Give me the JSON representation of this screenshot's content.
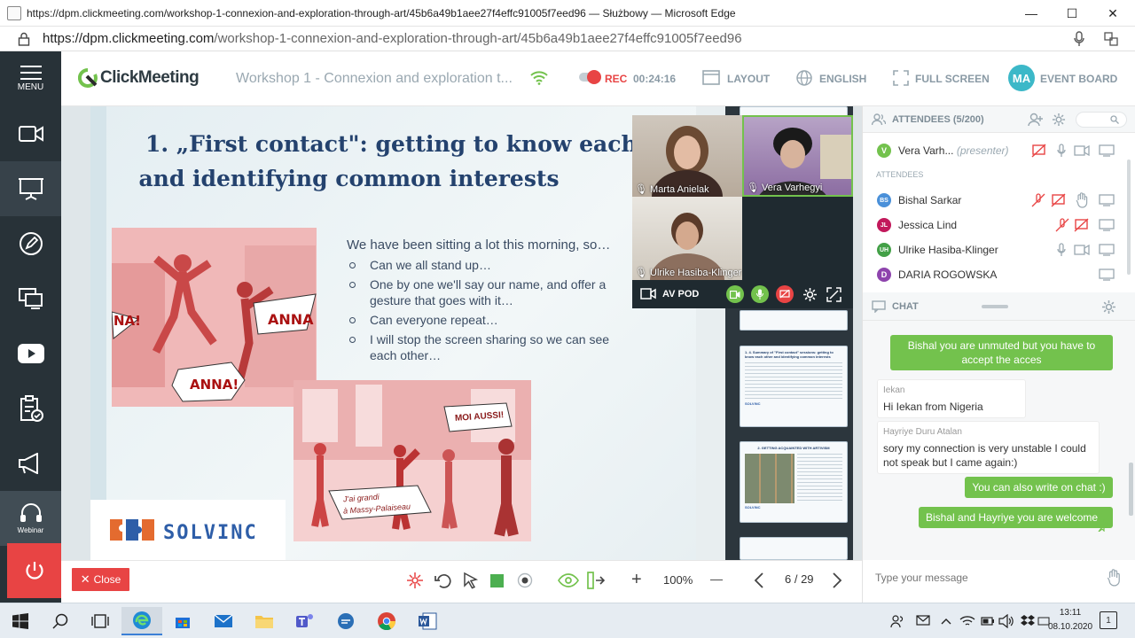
{
  "window": {
    "title": "https://dpm.clickmeeting.com/workshop-1-connexion-and-exploration-through-art/45b6a49b1aee27f4effc91005f7eed96 — Służbowy — Microsoft Edge",
    "minimize": "—",
    "maximize": "☐",
    "close": "✕"
  },
  "address": {
    "host": "https://dpm.clickmeeting.com",
    "path": "/workshop-1-connexion-and-exploration-through-art/45b6a49b1aee27f4effc91005f7eed96"
  },
  "sidebar": {
    "menu_label": "MENU",
    "webinar_label": "Webinar"
  },
  "header": {
    "logo": "ClickMeeting",
    "meeting_title": "Workshop 1 - Connexion and exploration t...",
    "rec_label": "REC",
    "rec_time": "00:24:16",
    "layout": "LAYOUT",
    "language": "ENGLISH",
    "fullscreen": "FULL SCREEN",
    "event_board_initials": "MA",
    "event_board": "EVENT BOARD"
  },
  "slide": {
    "title_line1": "1. „First contact\": getting to know each othe",
    "title_line2": "and identifying common interests",
    "intro": "We have been sitting a lot this morning, so…",
    "bullets": [
      "Can we all stand up…",
      "One by one we'll say our name, and offer a",
      "gesture that goes with it…",
      "Can everyone repeat…",
      "I will stop the screen sharing so we can see",
      "each other…"
    ],
    "photo1_labels": [
      "NA!",
      "ANNA",
      "ANNA!"
    ],
    "photo2_labels": [
      "MOI AUSSI!",
      "J'ai grandi",
      "à Massy-Palaiseau"
    ],
    "brand": "SOLVINC"
  },
  "thumbnails": {
    "t1_title": "1. 4. Summary of \"First contact\" sessions: getting to know each other and identifying common interests",
    "t2_title": "2. GETTING ACQUAINTED WITH ARTIVISM",
    "brand": "SOLVINC"
  },
  "video": {
    "p1": "Marta Anielak",
    "p2": "Vera Varhegyi",
    "p3": "Ulrike Hasiba-Klinger",
    "av_label": "AV POD"
  },
  "attendees": {
    "header": "ATTENDEES (5/200)",
    "presenter_name": "Vera Varh...",
    "presenter_tag": "(presenter)",
    "presenter_initial": "V",
    "section_label": "ATTENDEES",
    "list": [
      {
        "initials": "BS",
        "name": "Bishal Sarkar",
        "color": "#4a90d9"
      },
      {
        "initials": "JL",
        "name": "Jessica Lind",
        "color": "#c2185b"
      },
      {
        "initials": "UH",
        "name": "Ulrike Hasiba-Klinger",
        "color": "#43a047"
      },
      {
        "initials": "D",
        "name": "DARIA ROGOWSKA",
        "color": "#8e44ad"
      }
    ]
  },
  "chat": {
    "header": "CHAT",
    "m1": "Bishal you are unmuted but you have to accept the acces",
    "m2_sender": "Iekan",
    "m2": "Hi Iekan from Nigeria",
    "m3_sender": "Hayriye Duru Atalan",
    "m3": "sory my connection is very unstable I could not speak but I came again:)",
    "m4": "You can also write on chat :)",
    "m5": "Bishal and Hayriye you are welcome",
    "placeholder": "Type your message"
  },
  "bottom": {
    "close": "Close",
    "zoom": "100%",
    "zoom_plus": "+",
    "zoom_minus": "—",
    "page": "6 / 29"
  },
  "taskbar": {
    "time": "13:11",
    "date": "08.10.2020"
  },
  "colors": {
    "brand_green": "#73c24d",
    "rec_red": "#e84444",
    "sidebar": "#283238",
    "slide_title": "#24426e"
  }
}
